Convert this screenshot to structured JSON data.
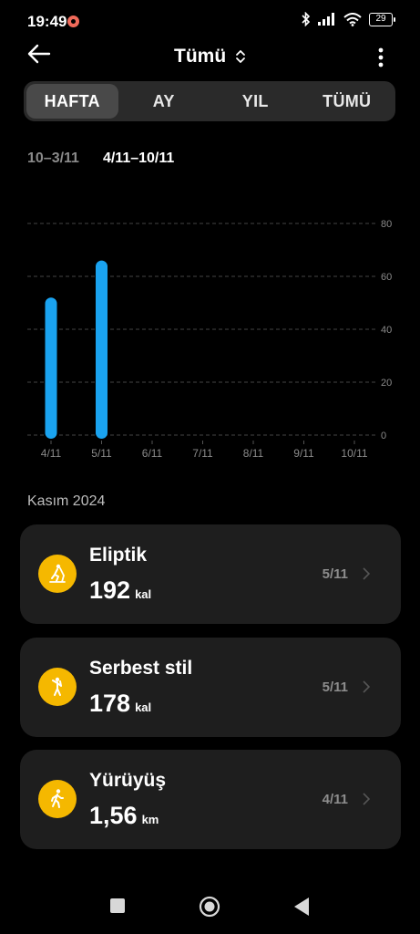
{
  "status": {
    "time": "19:49",
    "battery": "29"
  },
  "header": {
    "title": "Tümü"
  },
  "tabs": [
    {
      "label": "HAFTA",
      "active": true
    },
    {
      "label": "AY",
      "active": false
    },
    {
      "label": "YIL",
      "active": false
    },
    {
      "label": "TÜMÜ",
      "active": false
    }
  ],
  "weeks": {
    "prev": "10–3/11",
    "current": "4/11–10/11"
  },
  "chart_data": {
    "type": "bar",
    "categories": [
      "4/11",
      "5/11",
      "6/11",
      "7/11",
      "8/11",
      "9/11",
      "10/11"
    ],
    "values": [
      52,
      66,
      0,
      0,
      0,
      0,
      0
    ],
    "ylim": [
      0,
      80
    ],
    "yticks": [
      0,
      20,
      40,
      60,
      80
    ],
    "bar_color": "#1aa3f0",
    "grid": true
  },
  "month": "Kasım 2024",
  "activities": [
    {
      "name": "Eliptik",
      "value": "192",
      "unit": "kal",
      "date": "5/11",
      "icon": "elliptical-icon"
    },
    {
      "name": "Serbest stil",
      "value": "178",
      "unit": "kal",
      "date": "5/11",
      "icon": "freestyle-icon"
    },
    {
      "name": "Yürüyüş",
      "value": "1,56",
      "unit": "km",
      "date": "4/11",
      "icon": "walking-icon"
    }
  ],
  "colors": {
    "accent": "#f5b800",
    "card": "#1e1e1e",
    "bar": "#1aa3f0"
  }
}
